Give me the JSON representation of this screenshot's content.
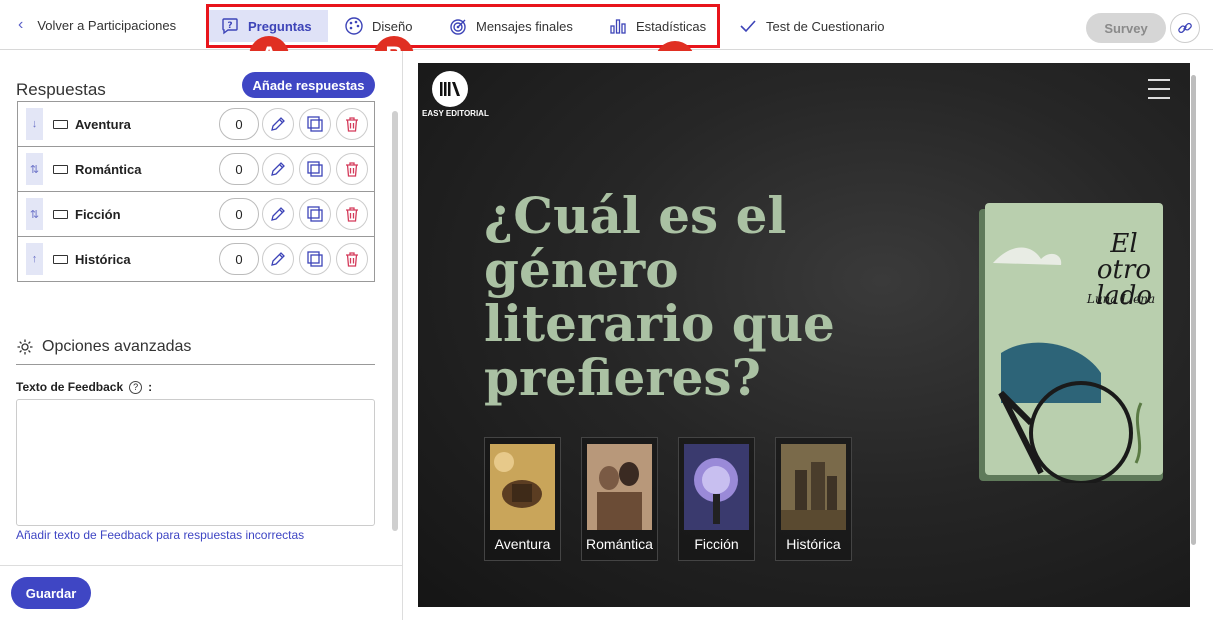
{
  "topbar": {
    "back_label": "Volver a Participaciones",
    "tabs": [
      {
        "label": "Preguntas",
        "icon": "question-bubble-icon",
        "active": true
      },
      {
        "label": "Diseño",
        "icon": "palette-icon",
        "active": false
      },
      {
        "label": "Mensajes finales",
        "icon": "target-icon",
        "active": false
      },
      {
        "label": "Estadísticas",
        "icon": "bar-chart-icon",
        "active": false
      },
      {
        "label": "Test de Cuestionario",
        "icon": "checkmark-icon",
        "active": false
      }
    ],
    "survey_label": "Survey",
    "link_icon": "link-icon"
  },
  "markers": [
    "A",
    "B",
    "C"
  ],
  "left": {
    "respuestas_title": "Respuestas",
    "add_button": "Añade respuestas",
    "answers": [
      {
        "label": "Aventura",
        "score": "0"
      },
      {
        "label": "Romántica",
        "score": "0"
      },
      {
        "label": "Ficción",
        "score": "0"
      },
      {
        "label": "Histórica",
        "score": "0"
      }
    ],
    "advanced_title": "Opciones avanzadas",
    "feedback_label": "Texto de Feedback",
    "feedback_colon": ":",
    "feedback_help": "?",
    "feedback_value": "",
    "feedback_link": "Añadir texto de Feedback para respuestas incorrectas",
    "save_button": "Guardar"
  },
  "preview": {
    "logo_text": "EASY EDITORIAL",
    "question": "¿Cuál es el género literario que prefieres?",
    "cards": [
      "Aventura",
      "Romántica",
      "Ficción",
      "Histórica"
    ],
    "book_title": "El otro lado",
    "book_author": "Luna Llena"
  },
  "colors": {
    "accent": "#3f46c4",
    "active_tab_bg": "#dfe2f7",
    "highlight": "#e8141b",
    "marker": "#e02f22",
    "question_text": "#aac1a3",
    "delete": "#d43a5a"
  }
}
